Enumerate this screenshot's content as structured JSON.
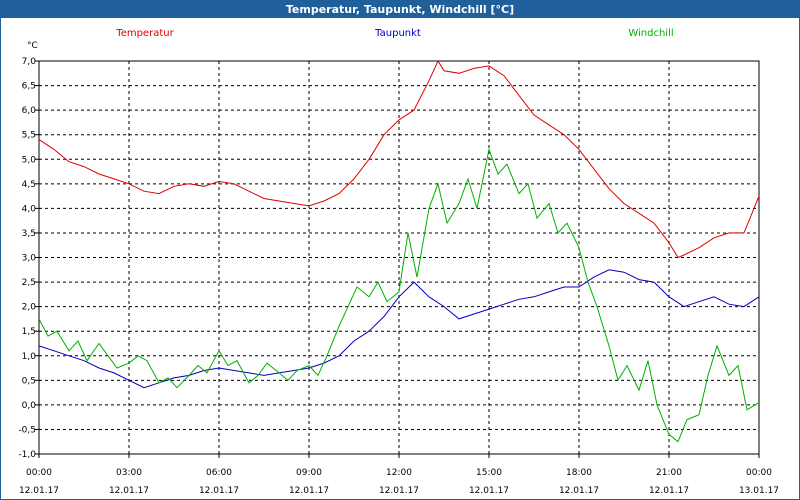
{
  "window": {
    "title": "Temperatur, Taupunkt, Windchill [°C]"
  },
  "chart_data": {
    "type": "line",
    "title": "Temperatur, Taupunkt, Windchill [°C]",
    "ylabel": "°C",
    "ylim": [
      -1.0,
      7.0
    ],
    "yticks": [
      "7,0",
      "6,5",
      "6,0",
      "5,5",
      "5,0",
      "4,5",
      "4,0",
      "3,5",
      "3,0",
      "2,5",
      "2,0",
      "1,5",
      "1,0",
      "0,5",
      "0,0",
      "-0,5",
      "-1,0"
    ],
    "xlim": [
      0,
      24
    ],
    "xticks": [
      {
        "time": "00:00",
        "date": "12.01.17"
      },
      {
        "time": "03:00",
        "date": "12.01.17"
      },
      {
        "time": "06:00",
        "date": "12.01.17"
      },
      {
        "time": "09:00",
        "date": "12.01.17"
      },
      {
        "time": "12:00",
        "date": "12.01.17"
      },
      {
        "time": "15:00",
        "date": "12.01.17"
      },
      {
        "time": "18:00",
        "date": "12.01.17"
      },
      {
        "time": "21:00",
        "date": "12.01.17"
      },
      {
        "time": "00:00",
        "date": "13.01.17"
      }
    ],
    "grid": true,
    "legend_position": "top",
    "series": [
      {
        "name": "Temperatur",
        "color": "#e00000",
        "x": [
          0,
          0.5,
          1,
          1.5,
          2,
          2.5,
          3,
          3.5,
          4,
          4.5,
          5,
          5.5,
          6,
          6.5,
          7,
          7.5,
          8,
          8.5,
          9,
          9.5,
          10,
          10.5,
          11,
          11.5,
          12,
          12.5,
          13,
          13.3,
          13.5,
          14,
          14.5,
          15,
          15.5,
          16,
          16.5,
          17,
          17.5,
          18,
          18.5,
          19,
          19.5,
          20,
          20.5,
          21,
          21.3,
          21.5,
          22,
          22.5,
          23,
          23.5,
          24
        ],
        "values": [
          5.4,
          5.2,
          4.95,
          4.85,
          4.7,
          4.6,
          4.5,
          4.35,
          4.3,
          4.45,
          4.5,
          4.45,
          4.55,
          4.5,
          4.35,
          4.2,
          4.15,
          4.1,
          4.05,
          4.15,
          4.3,
          4.6,
          5.0,
          5.5,
          5.8,
          6.0,
          6.6,
          7.0,
          6.8,
          6.75,
          6.85,
          6.9,
          6.7,
          6.3,
          5.9,
          5.7,
          5.5,
          5.2,
          4.8,
          4.4,
          4.1,
          3.9,
          3.7,
          3.3,
          3.0,
          3.05,
          3.2,
          3.4,
          3.5,
          3.5,
          4.25
        ]
      },
      {
        "name": "Taupunkt",
        "color": "#0000c0",
        "x": [
          0,
          0.5,
          1,
          1.5,
          2,
          2.5,
          3,
          3.5,
          4,
          4.5,
          5,
          5.5,
          6,
          6.5,
          7,
          7.5,
          8,
          8.5,
          9,
          9.5,
          10,
          10.5,
          11,
          11.5,
          12,
          12.5,
          13,
          13.5,
          14,
          14.5,
          15,
          15.5,
          16,
          16.5,
          17,
          17.5,
          18,
          18.5,
          19,
          19.5,
          20,
          20.5,
          21,
          21.5,
          22,
          22.5,
          23,
          23.5,
          24
        ],
        "values": [
          1.2,
          1.1,
          1.0,
          0.9,
          0.75,
          0.65,
          0.5,
          0.35,
          0.45,
          0.55,
          0.6,
          0.7,
          0.75,
          0.7,
          0.65,
          0.6,
          0.65,
          0.7,
          0.75,
          0.85,
          1.0,
          1.3,
          1.5,
          1.8,
          2.2,
          2.5,
          2.2,
          2.0,
          1.75,
          1.85,
          1.95,
          2.05,
          2.15,
          2.2,
          2.3,
          2.4,
          2.4,
          2.6,
          2.75,
          2.7,
          2.55,
          2.5,
          2.2,
          2.0,
          2.1,
          2.2,
          2.05,
          2.0,
          2.2
        ]
      },
      {
        "name": "Windchill",
        "color": "#00b000",
        "x": [
          0,
          0.3,
          0.6,
          1,
          1.3,
          1.6,
          2,
          2.3,
          2.6,
          3,
          3.3,
          3.6,
          4,
          4.3,
          4.6,
          5,
          5.3,
          5.6,
          6,
          6.3,
          6.6,
          7,
          7.3,
          7.6,
          8,
          8.3,
          8.6,
          9,
          9.3,
          9.6,
          10,
          10.3,
          10.6,
          11,
          11.3,
          11.6,
          12,
          12.3,
          12.6,
          13,
          13.3,
          13.6,
          14,
          14.3,
          14.6,
          15,
          15.3,
          15.6,
          16,
          16.3,
          16.6,
          17,
          17.3,
          17.6,
          18,
          18.3,
          18.6,
          19,
          19.3,
          19.6,
          20,
          20.3,
          20.6,
          21,
          21.3,
          21.6,
          22,
          22.3,
          22.6,
          23,
          23.3,
          23.6,
          24
        ],
        "values": [
          1.75,
          1.4,
          1.5,
          1.1,
          1.3,
          0.9,
          1.25,
          1.0,
          0.75,
          0.85,
          1.0,
          0.9,
          0.45,
          0.55,
          0.35,
          0.6,
          0.8,
          0.65,
          1.1,
          0.8,
          0.9,
          0.45,
          0.6,
          0.85,
          0.65,
          0.5,
          0.7,
          0.8,
          0.6,
          1.0,
          1.6,
          2.0,
          2.4,
          2.2,
          2.5,
          2.1,
          2.3,
          3.5,
          2.6,
          4.0,
          4.5,
          3.7,
          4.1,
          4.6,
          4.0,
          5.2,
          4.7,
          4.9,
          4.3,
          4.5,
          3.8,
          4.1,
          3.5,
          3.7,
          3.2,
          2.5,
          2.0,
          1.2,
          0.5,
          0.8,
          0.3,
          0.9,
          0.0,
          -0.6,
          -0.75,
          -0.3,
          -0.2,
          0.6,
          1.2,
          0.6,
          0.8,
          -0.1,
          0.05
        ]
      }
    ]
  }
}
